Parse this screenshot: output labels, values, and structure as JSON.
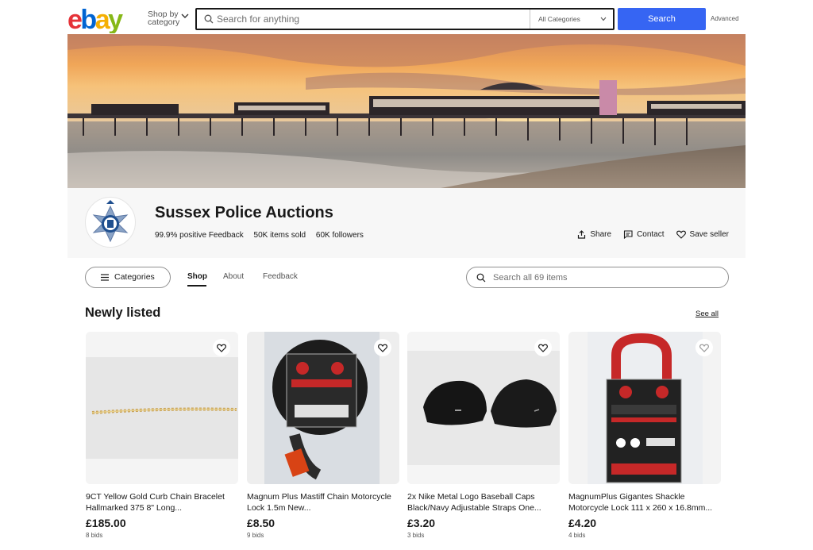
{
  "header": {
    "logo_text": "ebay",
    "shop_by_line1": "Shop by",
    "shop_by_line2": "category",
    "search_placeholder": "Search for anything",
    "category_select": "All Categories",
    "search_button": "Search",
    "advanced_link": "Advanced"
  },
  "store": {
    "name": "Sussex Police Auctions",
    "feedback": "99.9% positive Feedback",
    "items_sold": "50K items sold",
    "followers": "60K followers",
    "actions": {
      "share": "Share",
      "contact": "Contact",
      "save_seller": "Save seller"
    }
  },
  "nav": {
    "categories_button": "Categories",
    "tabs": [
      {
        "label": "Shop",
        "active": true
      },
      {
        "label": "About",
        "active": false
      },
      {
        "label": "Feedback",
        "active": false
      }
    ],
    "store_search_placeholder": "Search all 69 items"
  },
  "listings": {
    "title": "Newly listed",
    "see_all": "See all",
    "items": [
      {
        "title": "9CT Yellow Gold Curb Chain Bracelet Hallmarked 375 8\" Long...",
        "price": "£185.00",
        "bids": "8 bids"
      },
      {
        "title": "Magnum Plus Mastiff Chain Motorcycle Lock 1.5m New...",
        "price": "£8.50",
        "bids": "9 bids"
      },
      {
        "title": "2x Nike Metal Logo Baseball Caps Black/Navy Adjustable Straps One...",
        "price": "£3.20",
        "bids": "3 bids"
      },
      {
        "title": "MagnumPlus Gigantes Shackle Motorcycle Lock 111 x 260 x 16.8mm...",
        "price": "£4.20",
        "bids": "4 bids"
      }
    ]
  },
  "colors": {
    "accent_blue": "#3665f3",
    "logo_red": "#e53238",
    "logo_blue": "#0064d2",
    "logo_yellow": "#f5af02",
    "logo_green": "#86b817"
  }
}
